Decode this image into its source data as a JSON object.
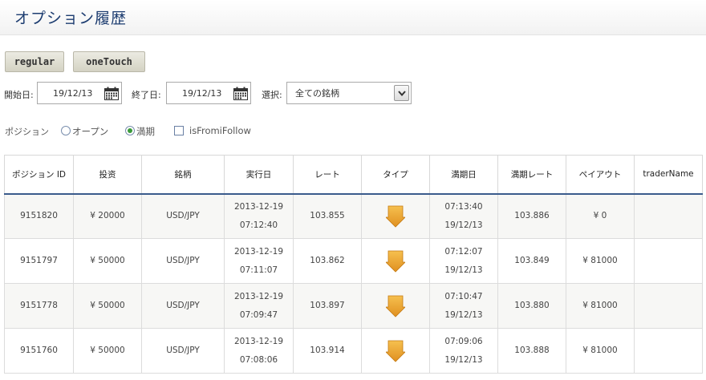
{
  "header": {
    "title": "オプション履歴"
  },
  "tabs": {
    "regular": "regular",
    "onetouch": "oneTouch"
  },
  "filters": {
    "start_label": "開始日:",
    "start_value": "19/12/13",
    "end_label": "終了日:",
    "end_value": "19/12/13",
    "select_label": "選択:",
    "select_value": "全ての銘柄"
  },
  "position": {
    "label": "ポジション",
    "open_label": "オープン",
    "expired_label": "満期",
    "checkbox_label": "isFromiFollow",
    "selected": "expired"
  },
  "table": {
    "columns": [
      "ポジション ID",
      "投资",
      "銘柄",
      "実行日",
      "レート",
      "タイプ",
      "満期日",
      "満期レート",
      "ペイアウト",
      "traderName"
    ],
    "rows": [
      {
        "id": "9151820",
        "investment": "¥ 20000",
        "symbol": "USD/JPY",
        "exec_date": "2013-12-19",
        "exec_time": "07:12:40",
        "rate": "103.855",
        "type": "arrow-down-icon",
        "expiry_time": "07:13:40",
        "expiry_date": "19/12/13",
        "expiry_rate": "103.886",
        "payout": "¥ 0",
        "trader": ""
      },
      {
        "id": "9151797",
        "investment": "¥ 50000",
        "symbol": "USD/JPY",
        "exec_date": "2013-12-19",
        "exec_time": "07:11:07",
        "rate": "103.862",
        "type": "arrow-down-icon",
        "expiry_time": "07:12:07",
        "expiry_date": "19/12/13",
        "expiry_rate": "103.849",
        "payout": "¥ 81000",
        "trader": ""
      },
      {
        "id": "9151778",
        "investment": "¥ 50000",
        "symbol": "USD/JPY",
        "exec_date": "2013-12-19",
        "exec_time": "07:09:47",
        "rate": "103.897",
        "type": "arrow-down-icon",
        "expiry_time": "07:10:47",
        "expiry_date": "19/12/13",
        "expiry_rate": "103.880",
        "payout": "¥ 81000",
        "trader": ""
      },
      {
        "id": "9151760",
        "investment": "¥ 50000",
        "symbol": "USD/JPY",
        "exec_date": "2013-12-19",
        "exec_time": "07:08:06",
        "rate": "103.914",
        "type": "arrow-down-icon",
        "expiry_time": "07:09:06",
        "expiry_date": "19/12/13",
        "expiry_rate": "103.888",
        "payout": "¥ 81000",
        "trader": ""
      }
    ]
  },
  "colors": {
    "title": "#1c3c70",
    "header_rule": "#3a5b8c",
    "arrow": "#f0a830",
    "radio_checked": "#3a9a3a"
  }
}
